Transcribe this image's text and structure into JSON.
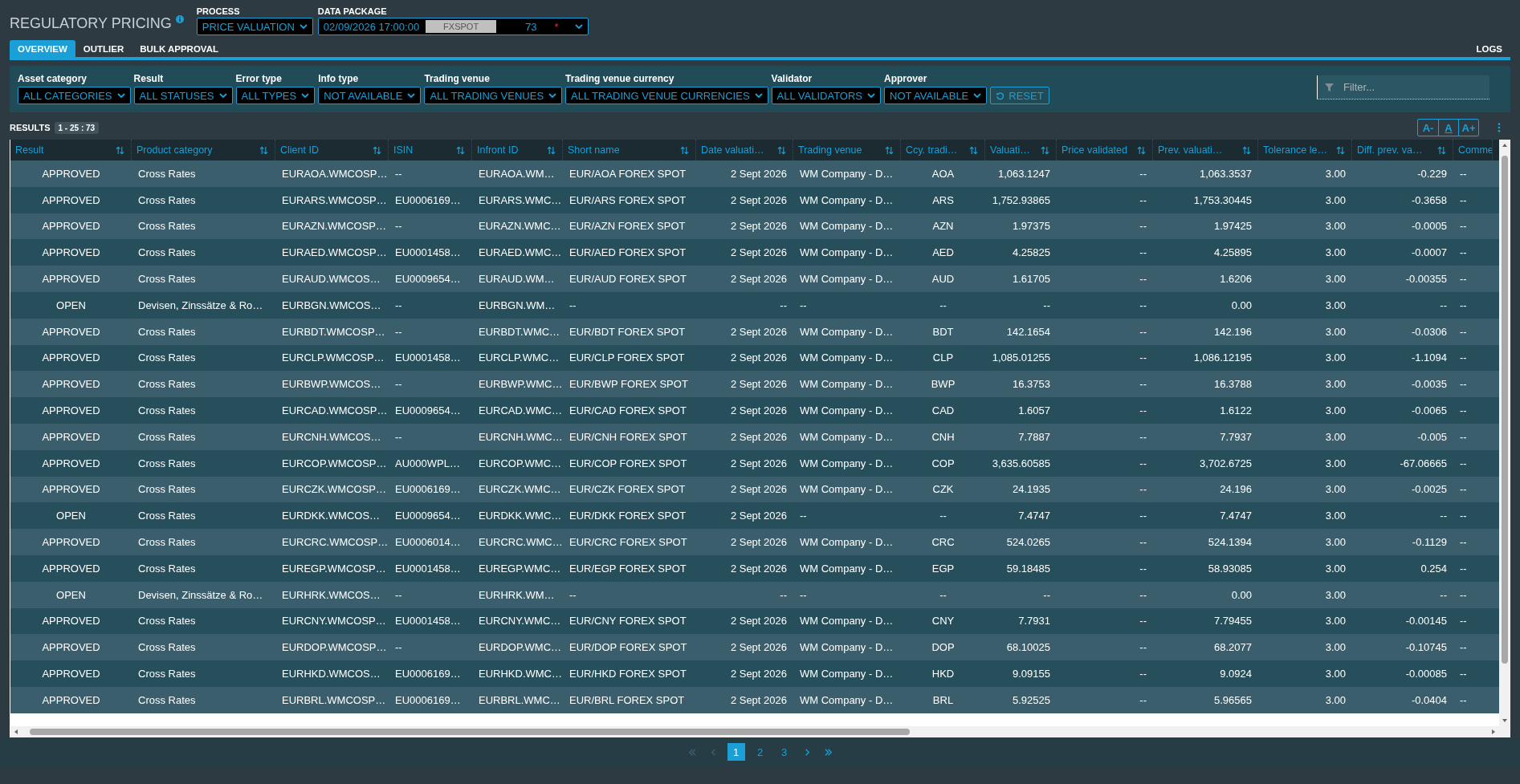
{
  "header": {
    "title": "REGULATORY PRICING",
    "process": {
      "label": "PROCESS",
      "value": "PRICE VALUATION"
    },
    "data_package": {
      "label": "DATA PACKAGE",
      "date": "02/09/2026 17:00:00",
      "tag": "FXSPOT",
      "count": "73",
      "flag": "*"
    }
  },
  "tabs": [
    {
      "label": "OVERVIEW",
      "selected": true
    },
    {
      "label": "OUTLIER",
      "selected": false
    },
    {
      "label": "BULK APPROVAL",
      "selected": false
    }
  ],
  "logs_tab": {
    "label": "LOGS",
    "selected": false
  },
  "filters": [
    {
      "label": "Asset category",
      "value": "ALL CATEGORIES"
    },
    {
      "label": "Result",
      "value": "ALL STATUSES"
    },
    {
      "label": "Error type",
      "value": "ALL TYPES"
    },
    {
      "label": "Info type",
      "value": "NOT AVAILABLE"
    },
    {
      "label": "Trading venue",
      "value": "ALL TRADING VENUES"
    },
    {
      "label": "Trading venue currency",
      "value": "ALL TRADING VENUE CURRENCIES"
    },
    {
      "label": "Validator",
      "value": "ALL VALIDATORS"
    },
    {
      "label": "Approver",
      "value": "NOT AVAILABLE"
    }
  ],
  "reset_label": "RESET",
  "filter_field": {
    "placeholder": "Filter..."
  },
  "results": {
    "label": "RESULTS",
    "range": "1 - 25 : 73"
  },
  "font_buttons": [
    "A-",
    "A",
    "A+"
  ],
  "table": {
    "columns": [
      "Result",
      "Product category",
      "Client ID",
      "ISIN",
      "Infront ID",
      "Short name",
      "Date valuati…",
      "Trading venue",
      "Ccy. tradi…",
      "Valuati…",
      "Price validated",
      "Prev. valuati…",
      "Tolerance le…",
      "Diff. prev. va…",
      "Comme"
    ],
    "rows": [
      [
        "APPROVED",
        "Cross Rates",
        "EURAOA.WMCOSP…",
        "--",
        "EURAOA.WM…",
        "EUR/AOA FOREX SPOT",
        "2 Sept 2026",
        "WM Company - D…",
        "AOA",
        "1,063.1247",
        "--",
        "1,063.3537",
        "3.00",
        "-0.229",
        "--"
      ],
      [
        "APPROVED",
        "Cross Rates",
        "EURARS.WMCOSP…",
        "EU0006169…",
        "EURARS.WMC…",
        "EUR/ARS FOREX SPOT",
        "2 Sept 2026",
        "WM Company - D…",
        "ARS",
        "1,752.93865",
        "--",
        "1,753.30445",
        "3.00",
        "-0.3658",
        "--"
      ],
      [
        "APPROVED",
        "Cross Rates",
        "EURAZN.WMCOSP…",
        "--",
        "EURAZN.WMC…",
        "EUR/AZN FOREX SPOT",
        "2 Sept 2026",
        "WM Company - D…",
        "AZN",
        "1.97375",
        "--",
        "1.97425",
        "3.00",
        "-0.0005",
        "--"
      ],
      [
        "APPROVED",
        "Cross Rates",
        "EURAED.WMCOSP…",
        "EU0001458…",
        "EURAED.WMC…",
        "EUR/AED FOREX SPOT",
        "2 Sept 2026",
        "WM Company - D…",
        "AED",
        "4.25825",
        "--",
        "4.25895",
        "3.00",
        "-0.0007",
        "--"
      ],
      [
        "APPROVED",
        "Cross Rates",
        "EURAUD.WMCOS…",
        "EU0009654…",
        "EURAUD.WM…",
        "EUR/AUD FOREX SPOT",
        "2 Sept 2026",
        "WM Company - D…",
        "AUD",
        "1.61705",
        "--",
        "1.6206",
        "3.00",
        "-0.00355",
        "--"
      ],
      [
        "OPEN",
        "Devisen, Zinssätze & Ro…",
        "EURBGN.WMCOS…",
        "--",
        "EURBGN.WM…",
        "--",
        "--",
        "--",
        "--",
        "--",
        "--",
        "0.00",
        "3.00",
        "--",
        "--"
      ],
      [
        "APPROVED",
        "Cross Rates",
        "EURBDT.WMCOSP…",
        "--",
        "EURBDT.WMC…",
        "EUR/BDT FOREX SPOT",
        "2 Sept 2026",
        "WM Company - D…",
        "BDT",
        "142.1654",
        "--",
        "142.196",
        "3.00",
        "-0.0306",
        "--"
      ],
      [
        "APPROVED",
        "Cross Rates",
        "EURCLP.WMCOSP…",
        "EU0001458…",
        "EURCLP.WMC…",
        "EUR/CLP FOREX SPOT",
        "2 Sept 2026",
        "WM Company - D…",
        "CLP",
        "1,085.01255",
        "--",
        "1,086.12195",
        "3.00",
        "-1.1094",
        "--"
      ],
      [
        "APPROVED",
        "Cross Rates",
        "EURBWP.WMCOS…",
        "--",
        "EURBWP.WMC…",
        "EUR/BWP FOREX SPOT",
        "2 Sept 2026",
        "WM Company - D…",
        "BWP",
        "16.3753",
        "--",
        "16.3788",
        "3.00",
        "-0.0035",
        "--"
      ],
      [
        "APPROVED",
        "Cross Rates",
        "EURCAD.WMCOSP…",
        "EU0009654…",
        "EURCAD.WMC…",
        "EUR/CAD FOREX SPOT",
        "2 Sept 2026",
        "WM Company - D…",
        "CAD",
        "1.6057",
        "--",
        "1.6122",
        "3.00",
        "-0.0065",
        "--"
      ],
      [
        "APPROVED",
        "Cross Rates",
        "EURCNH.WMCOS…",
        "--",
        "EURCNH.WMC…",
        "EUR/CNH FOREX SPOT",
        "2 Sept 2026",
        "WM Company - D…",
        "CNH",
        "7.7887",
        "--",
        "7.7937",
        "3.00",
        "-0.005",
        "--"
      ],
      [
        "APPROVED",
        "Cross Rates",
        "EURCOP.WMCOSP…",
        "AU000WPL…",
        "EURCOP.WMC…",
        "EUR/COP FOREX SPOT",
        "2 Sept 2026",
        "WM Company - D…",
        "COP",
        "3,635.60585",
        "--",
        "3,702.6725",
        "3.00",
        "-67.06665",
        "--"
      ],
      [
        "APPROVED",
        "Cross Rates",
        "EURCZK.WMCOSP…",
        "EU0006169…",
        "EURCZK.WMC…",
        "EUR/CZK FOREX SPOT",
        "2 Sept 2026",
        "WM Company - D…",
        "CZK",
        "24.1935",
        "--",
        "24.196",
        "3.00",
        "-0.0025",
        "--"
      ],
      [
        "OPEN",
        "Cross Rates",
        "EURDKK.WMCOS…",
        "EU0009654…",
        "EURDKK.WMC…",
        "EUR/DKK FOREX SPOT",
        "2 Sept 2026",
        "--",
        "--",
        "7.4747",
        "--",
        "7.4747",
        "3.00",
        "--",
        "--"
      ],
      [
        "APPROVED",
        "Cross Rates",
        "EURCRC.WMCOSP…",
        "EU0006014…",
        "EURCRC.WMC…",
        "EUR/CRC FOREX SPOT",
        "2 Sept 2026",
        "WM Company - D…",
        "CRC",
        "524.0265",
        "--",
        "524.1394",
        "3.00",
        "-0.1129",
        "--"
      ],
      [
        "APPROVED",
        "Cross Rates",
        "EUREGP.WMCOSP…",
        "EU0001458…",
        "EUREGP.WMC…",
        "EUR/EGP FOREX SPOT",
        "2 Sept 2026",
        "WM Company - D…",
        "EGP",
        "59.18485",
        "--",
        "58.93085",
        "3.00",
        "0.254",
        "--"
      ],
      [
        "OPEN",
        "Devisen, Zinssätze & Ro…",
        "EURHRK.WMCOS…",
        "--",
        "EURHRK.WM…",
        "--",
        "--",
        "--",
        "--",
        "--",
        "--",
        "0.00",
        "3.00",
        "--",
        "--"
      ],
      [
        "APPROVED",
        "Cross Rates",
        "EURCNY.WMCOSP…",
        "EU0001458…",
        "EURCNY.WMC…",
        "EUR/CNY FOREX SPOT",
        "2 Sept 2026",
        "WM Company - D…",
        "CNY",
        "7.7931",
        "--",
        "7.79455",
        "3.00",
        "-0.00145",
        "--"
      ],
      [
        "APPROVED",
        "Cross Rates",
        "EURDOP.WMCOSP…",
        "--",
        "EURDOP.WMC…",
        "EUR/DOP FOREX SPOT",
        "2 Sept 2026",
        "WM Company - D…",
        "DOP",
        "68.10025",
        "--",
        "68.2077",
        "3.00",
        "-0.10745",
        "--"
      ],
      [
        "APPROVED",
        "Cross Rates",
        "EURHKD.WMCOS…",
        "EU0006169…",
        "EURHKD.WMC…",
        "EUR/HKD FOREX SPOT",
        "2 Sept 2026",
        "WM Company - D…",
        "HKD",
        "9.09155",
        "--",
        "9.0924",
        "3.00",
        "-0.00085",
        "--"
      ],
      [
        "APPROVED",
        "Cross Rates",
        "EURBRL.WMCOSP…",
        "EU0006169…",
        "EURBRL.WMC…",
        "EUR/BRL FOREX SPOT",
        "2 Sept 2026",
        "WM Company - D…",
        "BRL",
        "5.92525",
        "--",
        "5.96565",
        "3.00",
        "-0.0404",
        "--"
      ]
    ]
  },
  "pager": {
    "controls": [
      {
        "kind": "first",
        "disabled": true
      },
      {
        "kind": "prev",
        "disabled": true
      },
      {
        "kind": "next",
        "disabled": false
      },
      {
        "kind": "last",
        "disabled": false
      }
    ],
    "pages": [
      {
        "label": "1",
        "selected": true
      },
      {
        "label": "2",
        "selected": false
      },
      {
        "label": "3",
        "selected": false
      }
    ]
  }
}
